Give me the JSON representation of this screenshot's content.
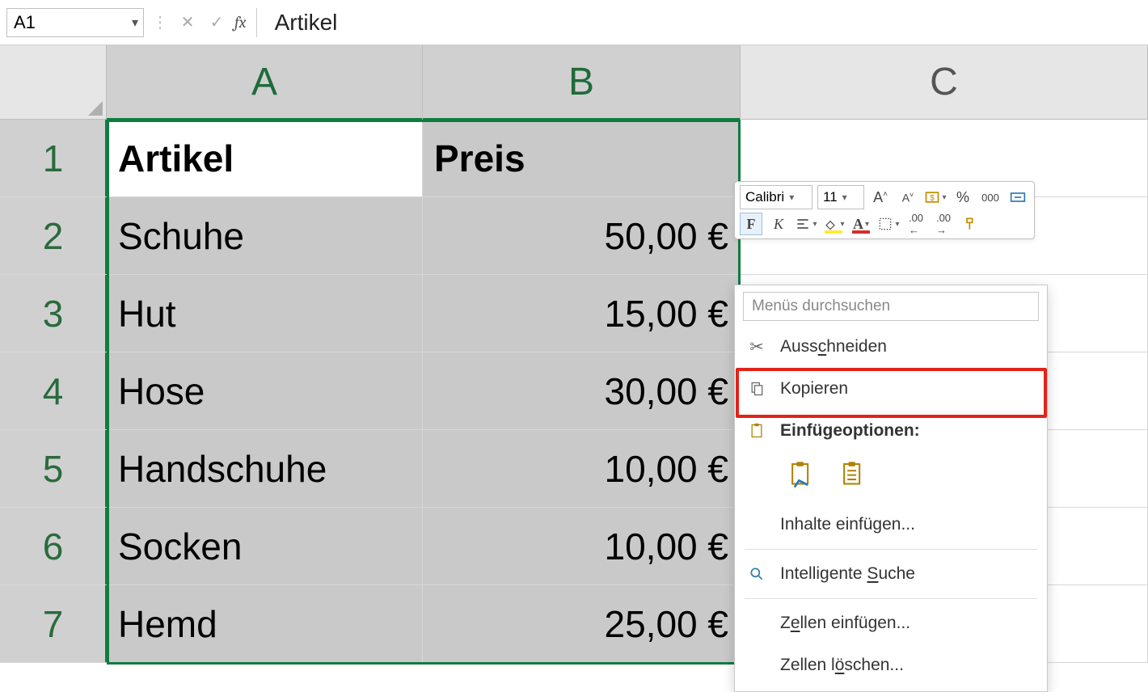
{
  "formula_bar": {
    "name_box": "A1",
    "fx_label": "fx",
    "text": "Artikel"
  },
  "columns": [
    "A",
    "B",
    "C"
  ],
  "rows": [
    {
      "n": "1",
      "a": "Artikel",
      "b": "Preis",
      "header": true
    },
    {
      "n": "2",
      "a": "Schuhe",
      "b": "50,00 €"
    },
    {
      "n": "3",
      "a": "Hut",
      "b": "15,00 €"
    },
    {
      "n": "4",
      "a": "Hose",
      "b": "30,00 €"
    },
    {
      "n": "5",
      "a": "Handschuhe",
      "b": "10,00 €"
    },
    {
      "n": "6",
      "a": "Socken",
      "b": "10,00 €"
    },
    {
      "n": "7",
      "a": "Hemd",
      "b": "25,00 €"
    }
  ],
  "mini_toolbar": {
    "font_name": "Calibri",
    "font_size": "11",
    "bold": "F",
    "italic": "K",
    "percent": "%",
    "thousands": "000"
  },
  "context_menu": {
    "search_placeholder": "Menüs durchsuchen",
    "cut": "Ausschneiden",
    "copy": "Kopieren",
    "paste_options": "Einfügeoptionen:",
    "paste_special": "Inhalte einfügen...",
    "smart_lookup": "Intelligente Suche",
    "insert_cells": "Zellen einfügen...",
    "delete_cells": "Zellen löschen...",
    "cut_hot": "c",
    "smart_hot": "S",
    "insert_hot": "e",
    "delete_hot": "ö"
  }
}
